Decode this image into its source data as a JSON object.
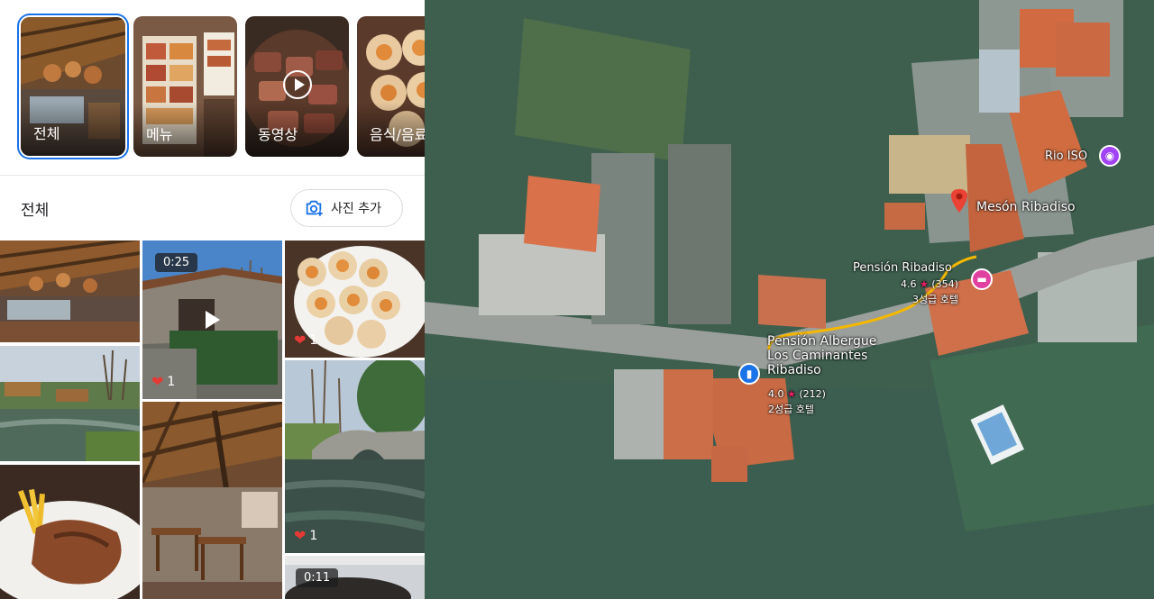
{
  "categories": [
    {
      "label": "전체",
      "selected": true
    },
    {
      "label": "메뉴",
      "selected": false
    },
    {
      "label": "동영상",
      "selected": false
    },
    {
      "label": "음식/음료",
      "selected": false
    }
  ],
  "section": {
    "title": "전체",
    "add_photo_label": "사진 추가"
  },
  "tiles": {
    "video1_duration": "0:25",
    "video1_likes": "1",
    "scallops_likes": "1",
    "river_likes": "1",
    "video2_duration": "0:11"
  },
  "map": {
    "place_main": "Mesón Ribadiso",
    "place_rio": "Rio ISO",
    "place_pension": "Pensión Ribadiso",
    "pension_rating": "4.6",
    "pension_reviews": "(354)",
    "pension_class": "3성급 호텔",
    "albergue_line1": "Pensión Albergue",
    "albergue_line2": "Los Caminantes",
    "albergue_line3": "Ribadiso",
    "albergue_rating": "4.0",
    "albergue_reviews": "(212)",
    "albergue_class": "2성급 호텔",
    "colors": {
      "pin": "#ea4335",
      "hotel": "#e040a0",
      "lodging_blue": "#1a73e8",
      "route": "#f5b800",
      "camera": "#a142f4"
    }
  }
}
